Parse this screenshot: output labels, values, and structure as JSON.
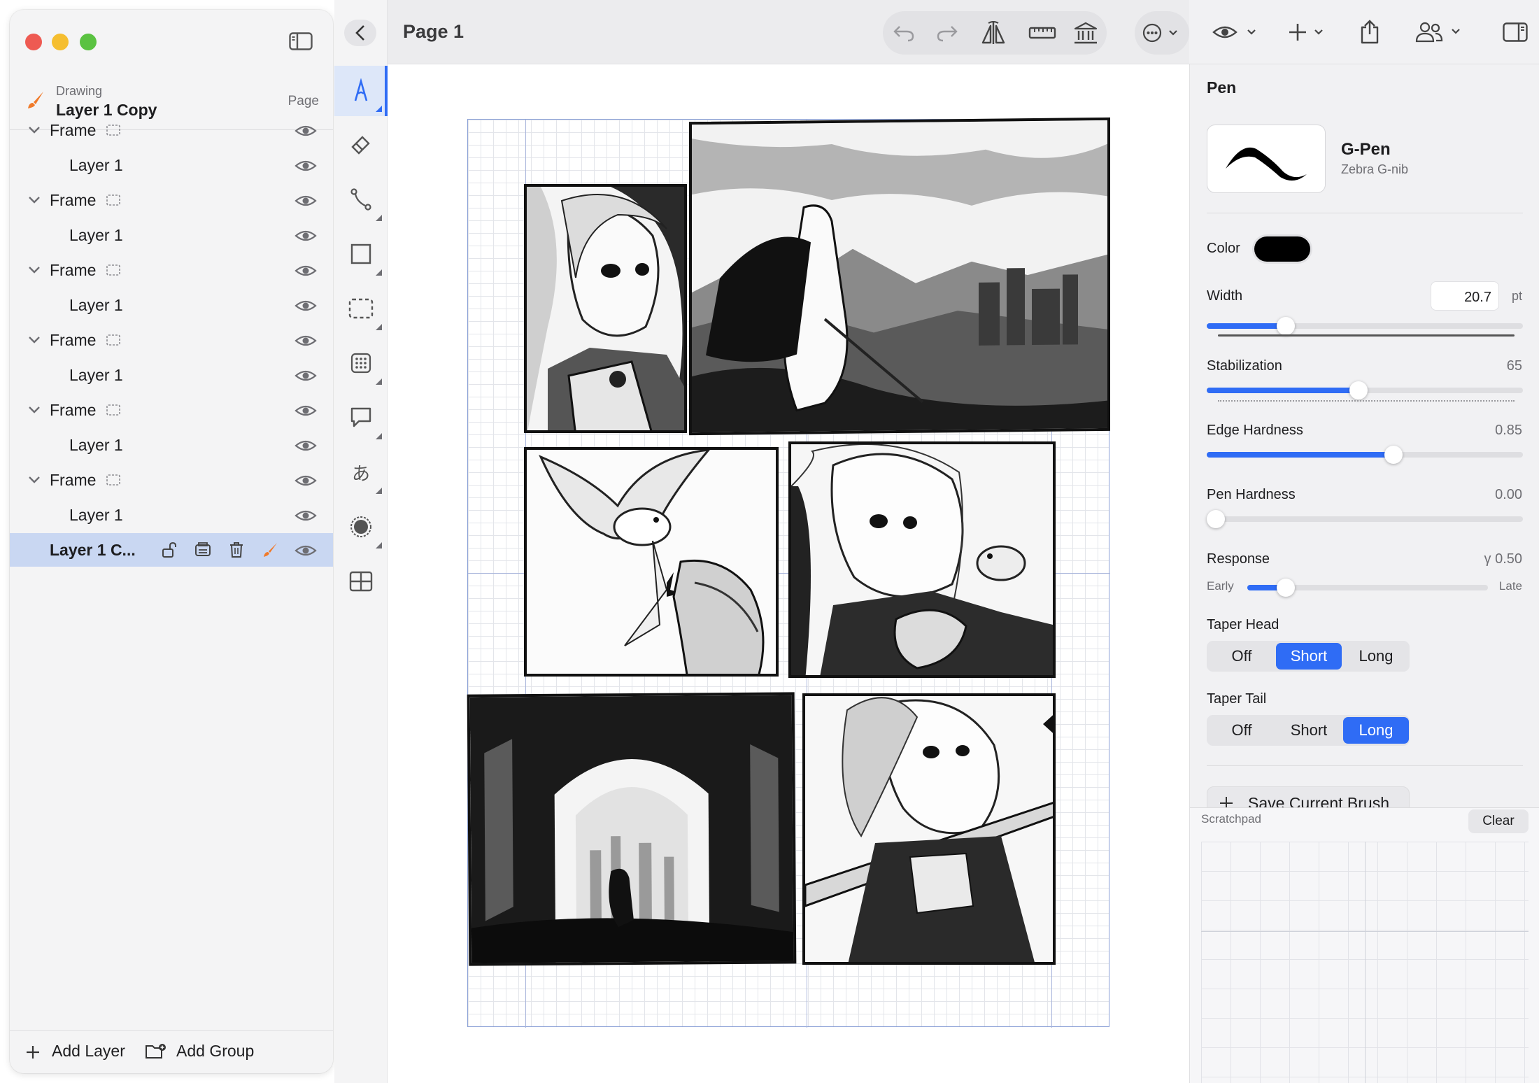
{
  "sidebar": {
    "doc_kind": "Drawing",
    "doc_title": "Layer 1 Copy",
    "doc_scope": "Page",
    "layers": [
      {
        "kind": "frame",
        "label": "Frame"
      },
      {
        "kind": "child",
        "label": "Layer 1"
      },
      {
        "kind": "frame",
        "label": "Frame"
      },
      {
        "kind": "child",
        "label": "Layer 1"
      },
      {
        "kind": "frame",
        "label": "Frame"
      },
      {
        "kind": "child",
        "label": "Layer 1"
      },
      {
        "kind": "frame",
        "label": "Frame"
      },
      {
        "kind": "child",
        "label": "Layer 1"
      },
      {
        "kind": "frame",
        "label": "Frame"
      },
      {
        "kind": "child",
        "label": "Layer 1"
      },
      {
        "kind": "frame",
        "label": "Frame"
      },
      {
        "kind": "child",
        "label": "Layer 1"
      },
      {
        "kind": "selected",
        "label": "Layer 1 C..."
      }
    ],
    "add_layer": "Add Layer",
    "add_group": "Add Group"
  },
  "toolbar": {
    "page_title": "Page 1",
    "icons": [
      "undo-icon",
      "redo-icon",
      "symmetry-icon",
      "ruler-icon",
      "library-icon",
      "more-icon",
      "eye-icon",
      "add-icon",
      "share-icon",
      "collaborate-icon",
      "inspector-toggle-icon"
    ]
  },
  "tools": [
    "pen-tool",
    "eraser-tool",
    "path-tool",
    "rectangle-tool",
    "selection-tool",
    "pattern-tool",
    "speech-bubble-tool",
    "text-tool",
    "fill-tool",
    "frame-grid-tool"
  ],
  "inspector": {
    "title": "Pen",
    "brush_name": "G-Pen",
    "brush_sub": "Zebra G-nib",
    "color_label": "Color",
    "color_value": "#000000",
    "width_label": "Width",
    "width_value": "20.7",
    "width_unit": "pt",
    "width_fraction": 0.25,
    "stabilization_label": "Stabilization",
    "stabilization_value": "65",
    "stabilization_fraction": 0.48,
    "edge_hardness_label": "Edge Hardness",
    "edge_hardness_value": "0.85",
    "edge_hardness_fraction": 0.59,
    "pen_hardness_label": "Pen Hardness",
    "pen_hardness_value": "0.00",
    "pen_hardness_fraction": 0.0,
    "response_label": "Response",
    "response_value": "γ 0.50",
    "response_early": "Early",
    "response_late": "Late",
    "response_fraction": 0.16,
    "taper_head_label": "Taper Head",
    "taper_head_options": [
      "Off",
      "Short",
      "Long"
    ],
    "taper_head_selected": "Short",
    "taper_tail_label": "Taper Tail",
    "taper_tail_options": [
      "Off",
      "Short",
      "Long"
    ],
    "taper_tail_selected": "Long",
    "save_brush": "Save Current Brush",
    "scratchpad_label": "Scratchpad",
    "clear_label": "Clear"
  },
  "colors": {
    "accent": "#2f6cf5",
    "selected_row": "#c9d7f2",
    "brush_icon": "#f07a2a"
  }
}
